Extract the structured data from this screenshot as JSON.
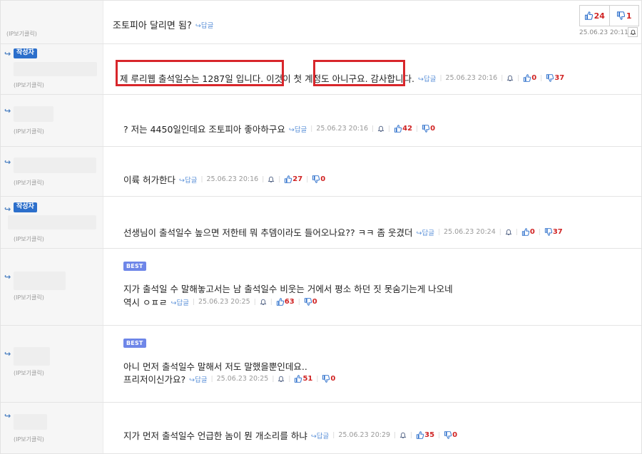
{
  "post": {
    "ip_label": "(IP보기클릭)",
    "text": "조토피아 달리면 됨?",
    "reply_label": "답글",
    "upvotes": "24",
    "downvotes": "1",
    "date": "25.06.23 20:11"
  },
  "comments": [
    {
      "is_author": true,
      "author_label": "작성자",
      "ip_label": "(IP보기클릭)",
      "lines": [
        "제 루리웹 출석일수는 1287일 입니다. 이것이 첫 계정도 아니구요. 감사합니다."
      ],
      "reply_label": "답글",
      "date": "25.06.23 20:16",
      "upvotes": "0",
      "downvotes": "37"
    },
    {
      "is_author": false,
      "ip_label": "(IP보기클릭)",
      "lines": [
        "? 저는 4450일인데요 조토피아 좋아하구요"
      ],
      "reply_label": "답글",
      "date": "25.06.23 20:16",
      "upvotes": "42",
      "downvotes": "0"
    },
    {
      "is_author": false,
      "ip_label": "(IP보기클릭)",
      "lines": [
        "이륙 허가한다"
      ],
      "reply_label": "답글",
      "date": "25.06.23 20:16",
      "upvotes": "27",
      "downvotes": "0"
    },
    {
      "is_author": true,
      "author_label": "작성자",
      "ip_label": "(IP보기클릭)",
      "lines": [
        "선생님이 출석일수 높으면 저한테 뭐 추뎀이라도 들어오나요?? ㅋㅋ 좀 웃겼더"
      ],
      "reply_label": "답글",
      "date": "25.06.23 20:24",
      "upvotes": "0",
      "downvotes": "37"
    },
    {
      "is_author": false,
      "best": "BEST",
      "ip_label": "(IP보기클릭)",
      "lines": [
        "지가 출석일 수 말해놓고서는 남 출석일수 비웃는 거에서 평소 하던 짓 못숨기는게 나오네",
        "역시 ㅇㅍㄹ"
      ],
      "reply_label": "답글",
      "date": "25.06.23 20:25",
      "upvotes": "63",
      "downvotes": "0"
    },
    {
      "is_author": false,
      "best": "BEST",
      "ip_label": "(IP보기클릭)",
      "lines": [
        "아니 먼저 출석일수 말해서 저도 말했을뿐인데요..",
        "프리저이신가요?"
      ],
      "reply_label": "답글",
      "date": "25.06.23 20:25",
      "upvotes": "51",
      "downvotes": "0"
    },
    {
      "is_author": false,
      "ip_label": "(IP보기클릭)",
      "lines": [
        "지가 먼저 출석일수 언급한 놈이 뭔 개소리를 하냐"
      ],
      "reply_label": "답글",
      "date": "25.06.23 20:29",
      "upvotes": "35",
      "downvotes": "0"
    }
  ],
  "colors": {
    "accent": "#d8262b",
    "link": "#5a90d8",
    "author_badge": "#2c6fcb",
    "best_badge": "#6e86e8",
    "vote": "#d02424"
  },
  "icons": {
    "reply": "reply-arrow-icon",
    "bell": "bell-icon",
    "thumbs_up": "thumbs-up-icon",
    "thumbs_down": "thumbs-down-icon"
  }
}
